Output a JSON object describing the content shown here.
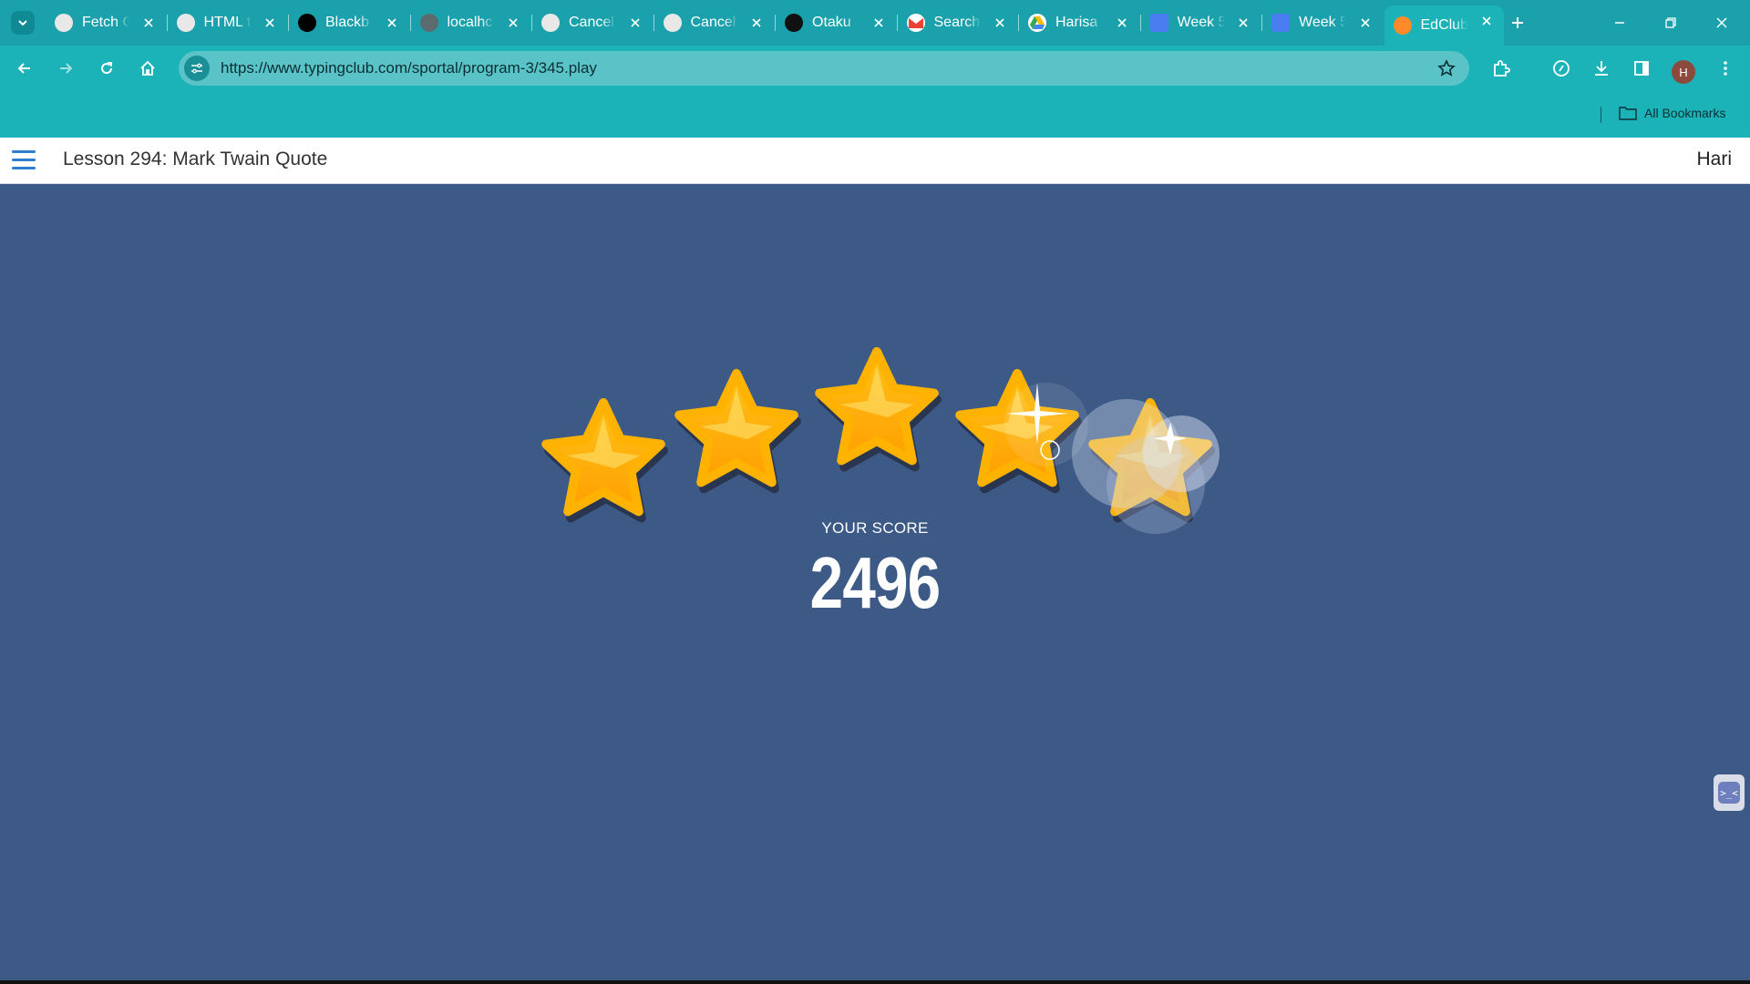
{
  "browser": {
    "tabs": [
      {
        "title": "Fetch C",
        "icon": "chatgpt-icon"
      },
      {
        "title": "HTML t",
        "icon": "chatgpt-icon"
      },
      {
        "title": "Blackb",
        "icon": "blackbox-icon"
      },
      {
        "title": "localhc",
        "icon": "globe-icon"
      },
      {
        "title": "Cancel",
        "icon": "chatgpt-icon"
      },
      {
        "title": "Cancel",
        "icon": "chatgpt-icon"
      },
      {
        "title": "Otaku",
        "icon": "github-icon"
      },
      {
        "title": "Search",
        "icon": "gmail-icon"
      },
      {
        "title": "Harisa",
        "icon": "drive-icon"
      },
      {
        "title": "Week 5",
        "icon": "docs-icon"
      },
      {
        "title": "Week 5",
        "icon": "docs-icon"
      },
      {
        "title": "EdClub",
        "icon": "edclub-icon",
        "active": true
      }
    ],
    "url": "https://www.typingclub.com/sportal/program-3/345.play",
    "profile_initial": "H",
    "bookmarks_label": "All Bookmarks"
  },
  "page": {
    "lesson_title": "Lesson 294: Mark Twain Quote",
    "user_name": "Hari"
  },
  "result": {
    "stars_earned": 5,
    "stars_total": 5,
    "score_label": "YOUR SCORE",
    "score_value": "2496"
  },
  "colors": {
    "chrome_teal": "#1bb3b8",
    "background": "#3d5a86",
    "star_gold": "#ffb000"
  }
}
